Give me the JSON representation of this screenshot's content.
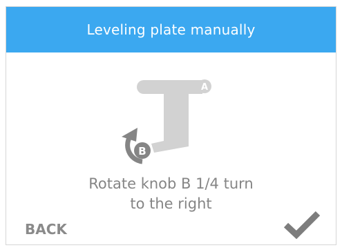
{
  "header": {
    "title": "Leveling plate manually",
    "background_color": "#3ba8f0"
  },
  "illustration": {
    "knob_a_label": "A",
    "knob_b_label": "B",
    "highlight_color": "#858585",
    "plate_color": "#d2d2d2"
  },
  "instruction": {
    "line1": "Rotate knob B 1/4 turn",
    "line2": "to the right"
  },
  "footer": {
    "back_label": "BACK",
    "confirm_icon": "checkmark-icon"
  }
}
